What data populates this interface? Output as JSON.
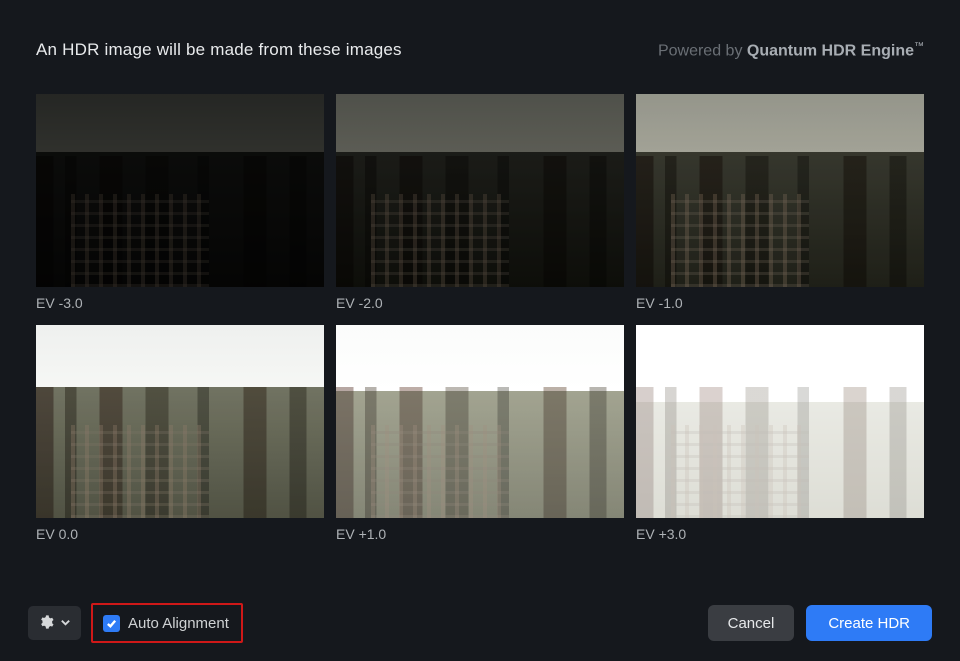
{
  "header": {
    "title": "An HDR image will be made from these images",
    "powered_prefix": "Powered by ",
    "powered_brand": "Quantum HDR Engine",
    "powered_tm": "™"
  },
  "thumbnails": [
    {
      "ev_label": "EV -3.0",
      "ev_class": "ev-n3"
    },
    {
      "ev_label": "EV -2.0",
      "ev_class": "ev-n2"
    },
    {
      "ev_label": "EV -1.0",
      "ev_class": "ev-n1"
    },
    {
      "ev_label": "EV 0.0",
      "ev_class": "ev-0"
    },
    {
      "ev_label": "EV +1.0",
      "ev_class": "ev-p1"
    },
    {
      "ev_label": "EV +3.0",
      "ev_class": "ev-p3"
    }
  ],
  "footer": {
    "settings_icon": "gear-icon",
    "settings_chevron": "chevron-down-icon",
    "auto_alignment_checked": true,
    "auto_alignment_label": "Auto Alignment",
    "cancel_label": "Cancel",
    "create_label": "Create HDR"
  },
  "colors": {
    "accent": "#2e7bf6",
    "highlight_box": "#cf1818",
    "bg": "#15181d"
  }
}
